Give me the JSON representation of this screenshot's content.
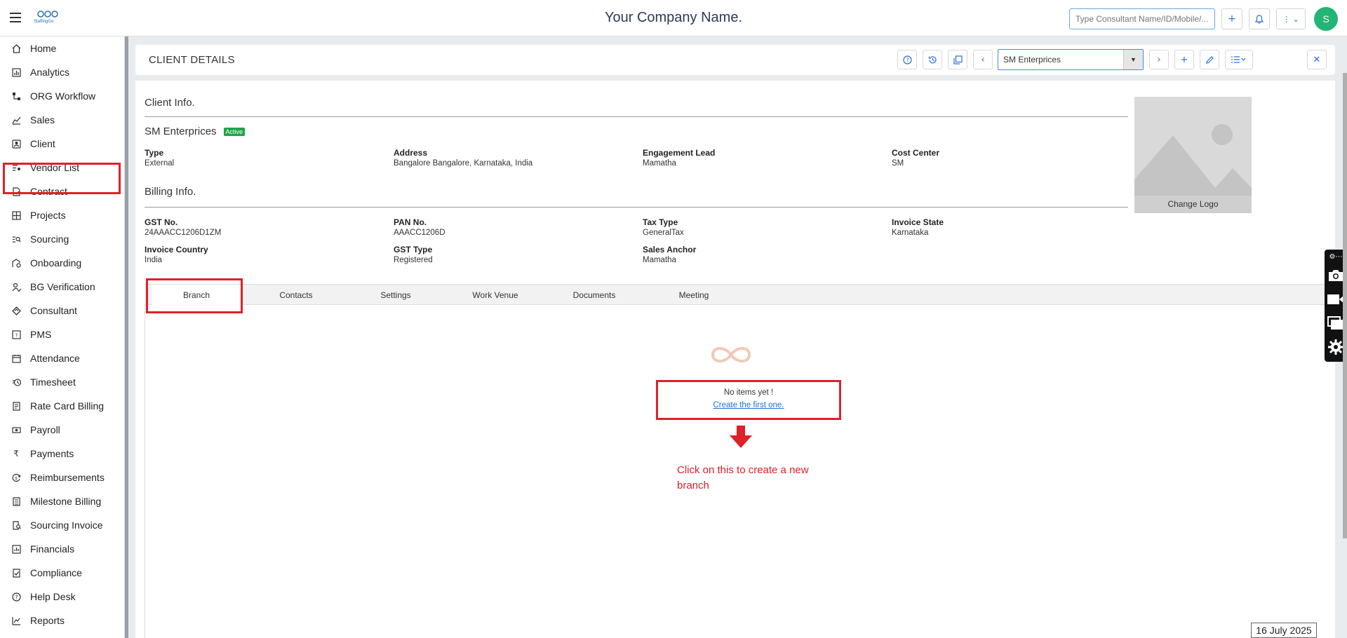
{
  "topbar": {
    "logo_text": "StaffingGo",
    "company_name": "Your Company Name.",
    "search_placeholder": "Type Consultant Name/ID/Mobile/...",
    "avatar_initial": "S"
  },
  "sidebar": {
    "items": [
      {
        "label": "Home",
        "icon": "home-icon"
      },
      {
        "label": "Analytics",
        "icon": "analytics-icon"
      },
      {
        "label": "ORG Workflow",
        "icon": "workflow-icon"
      },
      {
        "label": "Sales",
        "icon": "sales-icon"
      },
      {
        "label": "Client",
        "icon": "client-icon"
      },
      {
        "label": "Vendor List",
        "icon": "vendor-icon"
      },
      {
        "label": "Contract",
        "icon": "contract-icon"
      },
      {
        "label": "Projects",
        "icon": "projects-icon"
      },
      {
        "label": "Sourcing",
        "icon": "sourcing-icon"
      },
      {
        "label": "Onboarding",
        "icon": "onboarding-icon"
      },
      {
        "label": "BG Verification",
        "icon": "bg-verification-icon"
      },
      {
        "label": "Consultant",
        "icon": "consultant-icon"
      },
      {
        "label": "PMS",
        "icon": "pms-icon"
      },
      {
        "label": "Attendance",
        "icon": "calendar-icon"
      },
      {
        "label": "Timesheet",
        "icon": "timesheet-icon"
      },
      {
        "label": "Rate Card Billing",
        "icon": "rate-card-icon"
      },
      {
        "label": "Payroll",
        "icon": "payroll-icon"
      },
      {
        "label": "Payments",
        "icon": "rupee-icon"
      },
      {
        "label": "Reimbursements",
        "icon": "reimbursement-icon"
      },
      {
        "label": "Milestone Billing",
        "icon": "milestone-icon"
      },
      {
        "label": "Sourcing Invoice",
        "icon": "invoice-icon"
      },
      {
        "label": "Financials",
        "icon": "financials-icon"
      },
      {
        "label": "Compliance",
        "icon": "compliance-icon"
      },
      {
        "label": "Help Desk",
        "icon": "help-icon"
      },
      {
        "label": "Reports",
        "icon": "reports-icon"
      }
    ]
  },
  "header": {
    "title": "CLIENT DETAILS",
    "selected_client": "SM Enterprices"
  },
  "client_info": {
    "section_title": "Client Info.",
    "name": "SM Enterprices",
    "status": "Active",
    "fields": [
      {
        "key": "Type",
        "value": "External"
      },
      {
        "key": "Address",
        "value": "Bangalore Bangalore, Karnataka, India"
      },
      {
        "key": "Engagement Lead",
        "value": "Mamatha"
      },
      {
        "key": "Cost Center",
        "value": "SM"
      }
    ]
  },
  "billing_info": {
    "section_title": "Billing Info.",
    "fields": [
      {
        "key": "GST No.",
        "value": "24AAACC1206D1ZM"
      },
      {
        "key": "PAN No.",
        "value": "AAACC1206D"
      },
      {
        "key": "Tax Type",
        "value": "GeneralTax"
      },
      {
        "key": "Invoice State",
        "value": "Karnataka"
      },
      {
        "key": "Invoice Country",
        "value": "India"
      },
      {
        "key": "GST Type",
        "value": "Registered"
      },
      {
        "key": "Sales Anchor",
        "value": "Mamatha"
      }
    ]
  },
  "logo_panel": {
    "caption": "Change Logo"
  },
  "tabs": [
    {
      "label": "Branch",
      "active": true
    },
    {
      "label": "Contacts"
    },
    {
      "label": "Settings"
    },
    {
      "label": "Work Venue"
    },
    {
      "label": "Documents"
    },
    {
      "label": "Meeting"
    }
  ],
  "empty_state": {
    "message": "No items yet !",
    "link": "Create the first one."
  },
  "annotation": {
    "note": "Click on this to create a new branch",
    "highlight_color": "#e0202a"
  },
  "date_stamp": "16 July 2025",
  "colors": {
    "accent": "#2a6fd6",
    "avatar": "#22b573",
    "active_badge": "#1ea447"
  }
}
